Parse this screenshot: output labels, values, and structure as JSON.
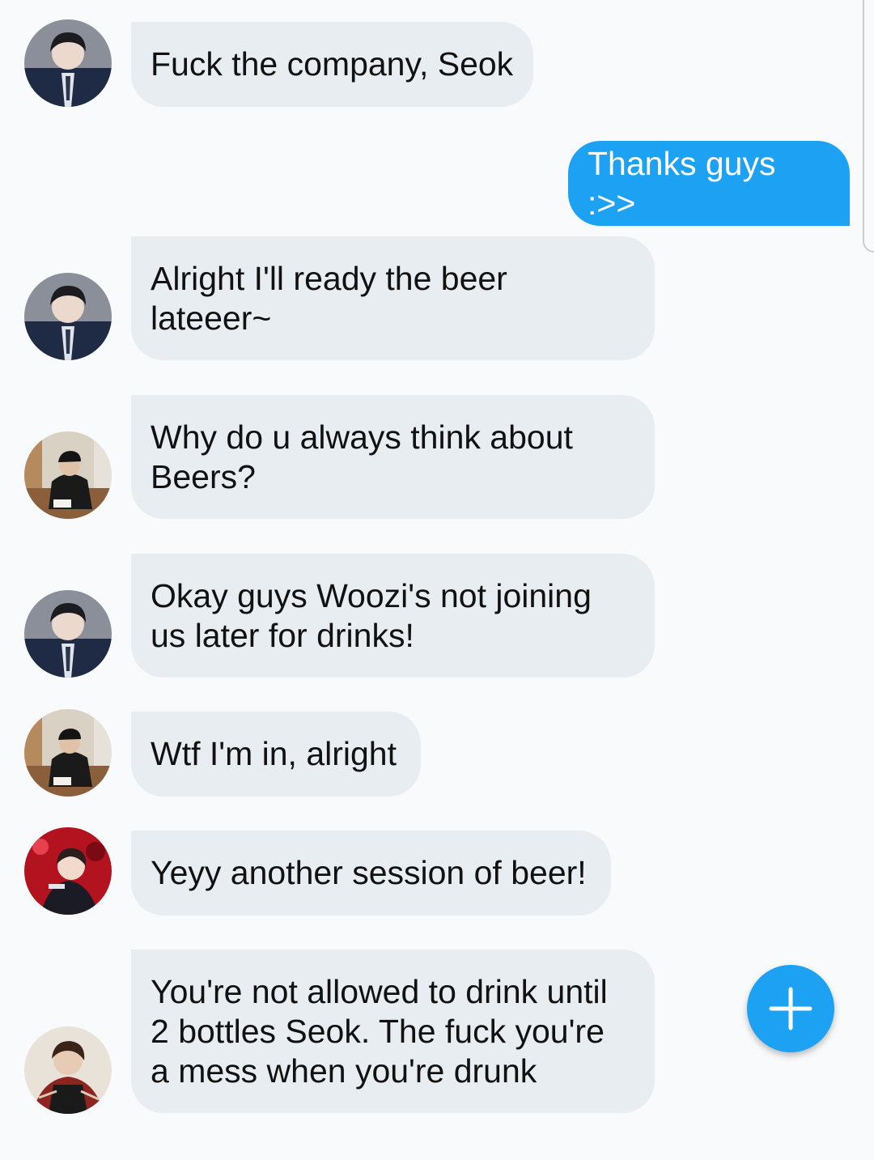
{
  "messages": [
    {
      "text": "Fuck the company, Seok",
      "direction": "received",
      "avatar": "avatar-suit-boy-icon"
    },
    {
      "text": "Thanks guys :>>",
      "direction": "sent"
    },
    {
      "text": "Alright I'll ready the beer\nlateeer~",
      "direction": "received",
      "avatar": "avatar-suit-boy-icon"
    },
    {
      "text": "Why do u always think about\nBeers?",
      "direction": "received",
      "avatar": "avatar-cap-boy-icon"
    },
    {
      "text": "Okay guys Woozi's not joining\nus later for drinks!",
      "direction": "received",
      "avatar": "avatar-suit-boy-icon"
    },
    {
      "text": "Wtf I'm in, alright",
      "direction": "received",
      "avatar": "avatar-cap-boy-icon"
    },
    {
      "text": "Yeyy another session of beer!",
      "direction": "received",
      "avatar": "avatar-stage-boy-icon"
    },
    {
      "text": "You're not allowed to drink until\n2 bottles Seok. The fuck you're\na mess when you're drunk",
      "direction": "received",
      "avatar": "avatar-plaid-boy-icon"
    }
  ],
  "fab": {
    "icon": "plus-icon"
  },
  "colors": {
    "background": "#f9fafb",
    "received_bubble": "#e8edf1",
    "sent_bubble": "#1da1f2",
    "fab": "#1da1f2"
  }
}
